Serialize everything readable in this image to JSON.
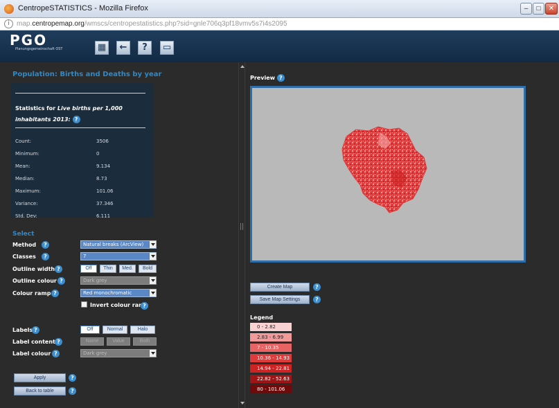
{
  "browser": {
    "window_title": "CentropeSTATISTICS - Mozilla Firefox",
    "url_prefix": "map.",
    "url_domain": "centropemap.org",
    "url_path": "/wmscs/centropestatistics.php?sid=gnle706q3pf18vmv5s7i4s2095",
    "min": "–",
    "max": "□",
    "close": "✕"
  },
  "header": {
    "logo_text": "PGO",
    "logo_sub": "Planungsgemeinschaft OST",
    "buttons": [
      {
        "name": "map-view-button",
        "glyph": "▦"
      },
      {
        "name": "back-button",
        "glyph": "←"
      },
      {
        "name": "help-button",
        "glyph": "?"
      },
      {
        "name": "window-button",
        "glyph": "▭"
      }
    ]
  },
  "panel": {
    "title": "Population: Births and Deaths by year",
    "stats_heading_prefix": "Statistics for",
    "stats_heading_italic": "Live births per 1,000 inhabitants 2013:",
    "stats": [
      {
        "label": "Count:",
        "value": "3506"
      },
      {
        "label": "Minimum:",
        "value": "0"
      },
      {
        "label": "Mean:",
        "value": "9.134"
      },
      {
        "label": "Median:",
        "value": "8.73"
      },
      {
        "label": "Maximum:",
        "value": "101.06"
      },
      {
        "label": "Variance:",
        "value": "37.346"
      },
      {
        "label": "Std. Dev:",
        "value": "6.111"
      }
    ],
    "select_heading": "Select",
    "method_label": "Method",
    "method_value": "Natural breaks (ArcView)",
    "classes_label": "Classes",
    "classes_value": "7",
    "outline_width_label": "Outline width",
    "outline_width_options": [
      "Off",
      "Thin",
      "Med.",
      "Bold"
    ],
    "outline_colour_label": "Outline colour",
    "outline_colour_value": "Dark grey",
    "colour_ramp_label": "Colour ramp",
    "colour_ramp_value": "Red monochromatic",
    "invert_label": "Invert colour ramp",
    "labels_label": "Labels",
    "labels_options": [
      "Off",
      "Normal",
      "Halo"
    ],
    "label_content_label": "Label content",
    "label_content_options": [
      "Name",
      "Value",
      "Both"
    ],
    "label_colour_label": "Label colour",
    "label_colour_value": "Dark grey",
    "apply_label": "Apply",
    "back_label": "Back to table",
    "help_glyph": "?"
  },
  "preview": {
    "label": "Preview",
    "create_map_label": "Create Map",
    "save_settings_label": "Save Map Settings",
    "legend_title": "Legend",
    "legend": [
      {
        "range": "0 - 2.82",
        "color": "#f9d3d3"
      },
      {
        "range": "2.83 - 6.99",
        "color": "#f29a9a"
      },
      {
        "range": "7 - 10.35",
        "color": "#e86464"
      },
      {
        "range": "10.36 - 14.93",
        "color": "#e03a3a"
      },
      {
        "range": "14.94 - 22.81",
        "color": "#cc2424"
      },
      {
        "range": "22.82 - 52.63",
        "color": "#9f1515"
      },
      {
        "range": "80 - 101.06",
        "color": "#6e0a0a"
      }
    ]
  }
}
